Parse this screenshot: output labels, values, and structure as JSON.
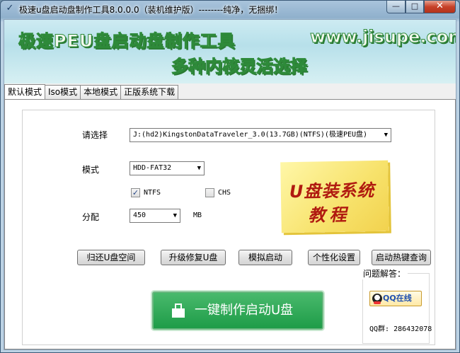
{
  "window": {
    "title": "极速u盘启动盘制作工具8.0.0.0（装机维护版）--------纯净，无捆绑！",
    "app_icon": "check-icon",
    "controls": {
      "minimize": "—",
      "maximize": "□",
      "close": "✕"
    }
  },
  "banner": {
    "title": "极速PEU盘启动盘制作工具",
    "site": "www.jisupe.com",
    "subtitle": "多种内核灵活选择"
  },
  "tabs": [
    {
      "label": "默认模式",
      "active": true
    },
    {
      "label": "Iso模式",
      "active": false
    },
    {
      "label": "本地模式",
      "active": false
    },
    {
      "label": "正版系统下载",
      "active": false
    }
  ],
  "form": {
    "select_label": "请选择",
    "device_value": "J:(hd2)KingstonDataTraveler_3.0(13.7GB)(NTFS)(极速PEU盘)",
    "mode_label": "模式",
    "mode_value": "HDD-FAT32",
    "ntfs_label": "NTFS",
    "ntfs_checked": true,
    "chs_label": "CHS",
    "chs_checked": false,
    "alloc_label": "分配",
    "alloc_value": "450",
    "alloc_unit": "MB",
    "dropdown_arrow": "▼"
  },
  "sticky": {
    "line1": "U盘装系统",
    "line2": "教程"
  },
  "buttons": {
    "restore": "归还U盘空间",
    "upgrade": "升级修复U盘",
    "simulate": "模拟启动",
    "personalize": "个性化设置",
    "hotkey": "启动热键查询",
    "make": "一键制作启动U盘"
  },
  "help": {
    "title": "问题解答：",
    "qq_online": "QQ在线",
    "qq_group": "QQ群: 286432078"
  }
}
